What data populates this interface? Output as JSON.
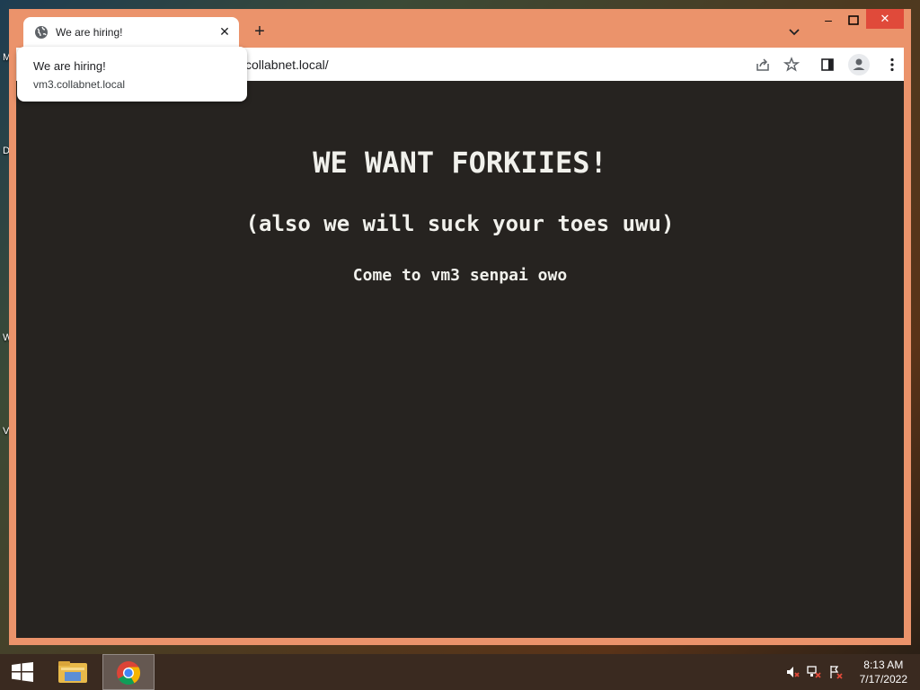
{
  "desktop": {
    "edge_labels": [
      "M",
      "D",
      "W",
      "V"
    ]
  },
  "browser": {
    "tab": {
      "title": "We are hiring!",
      "close_glyph": "✕"
    },
    "new_tab_glyph": "+",
    "window_controls": {
      "minimize": "–",
      "close": "✕"
    },
    "address_bar": {
      "url_visible": "collabnet.local/"
    },
    "hover_card": {
      "title": "We are hiring!",
      "url": "vm3.collabnet.local"
    },
    "accent_color": "#eb936b"
  },
  "page": {
    "heading": "WE WANT FORKIIES!",
    "subheading": "(also we will suck your toes uwu)",
    "body_text": "Come to vm3 senpai owo",
    "background_color": "#262320"
  },
  "taskbar": {
    "items": [
      {
        "name": "start-button",
        "icon": "windows-logo-icon"
      },
      {
        "name": "file-explorer",
        "icon": "folder-icon"
      },
      {
        "name": "chrome",
        "icon": "chrome-icon",
        "active": true
      }
    ],
    "tray_icons": [
      "speaker-muted-icon",
      "network-disconnected-icon",
      "action-center-icon"
    ],
    "clock": {
      "time": "8:13 AM",
      "date": "7/17/2022"
    }
  }
}
